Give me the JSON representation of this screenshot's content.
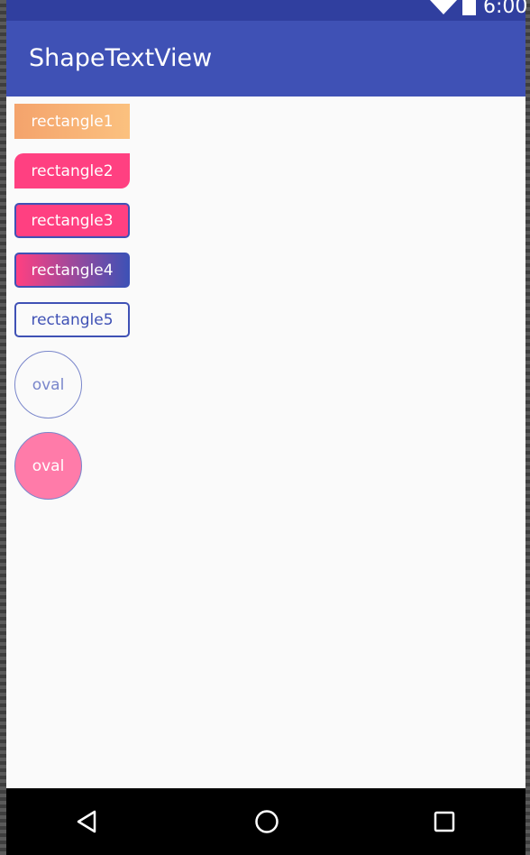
{
  "status_bar": {
    "time": "6:00",
    "icons": [
      "wifi-icon",
      "battery-icon"
    ],
    "color": "#303f9f"
  },
  "app_bar": {
    "title": "ShapeTextView",
    "color": "#3f51b5"
  },
  "shapes": [
    {
      "label": "rectangle1",
      "kind": "rectangle",
      "fill": "gradient #f4a36c to #fbc17f",
      "text_color": "#ffffff"
    },
    {
      "label": "rectangle2",
      "kind": "rectangle",
      "fill": "#ff4081",
      "corners": "top-left and bottom-right rounded",
      "text_color": "#ffffff"
    },
    {
      "label": "rectangle3",
      "kind": "rectangle",
      "fill": "#ff4081",
      "stroke": "#3f51b5",
      "text_color": "#ffffff"
    },
    {
      "label": "rectangle4",
      "kind": "rectangle",
      "fill": "gradient #ff4081 to #3f51b5",
      "stroke": "#3f51b5",
      "text_color": "#ffffff"
    },
    {
      "label": "rectangle5",
      "kind": "rectangle",
      "fill": "#fafafa",
      "stroke": "#3f51b5",
      "text_color": "#3f51b5"
    },
    {
      "label": "oval",
      "kind": "oval",
      "fill": "#fafafa",
      "stroke": "#7986cb",
      "text_color": "#7986cb"
    },
    {
      "label": "oval",
      "kind": "oval",
      "fill": "#ff7ba9",
      "stroke": "#7986cb",
      "text_color": "#ffffff"
    }
  ],
  "nav_bar": {
    "buttons": [
      "back-icon",
      "home-icon",
      "recents-icon"
    ],
    "color": "#000000"
  }
}
